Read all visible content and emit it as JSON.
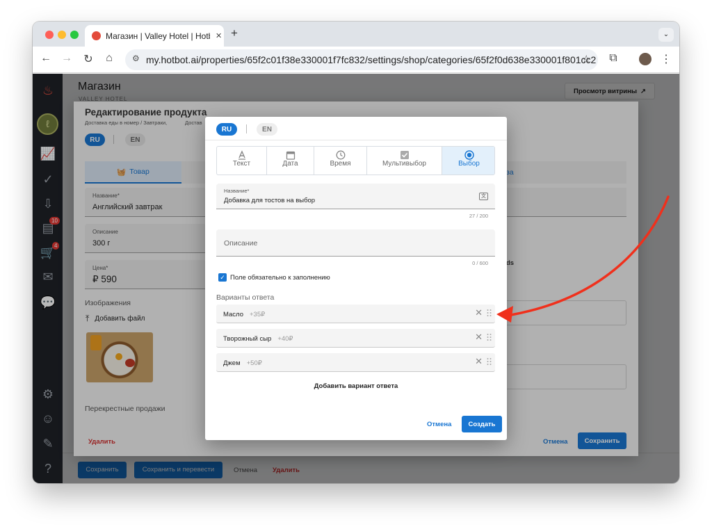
{
  "browser": {
    "tab_title": "Магазин | Valley Hotel | Hotbot",
    "new_tab": "+",
    "url": "my.hotbot.ai/properties/65f2c01f38e330001f7fc832/settings/shop/categories/65f2f0d638e330001f801cc2"
  },
  "page": {
    "title": "Магазин",
    "subtitle": "VALLEY HOTEL",
    "storefront_button": "Просмотр витрины",
    "bottom_save": "Сохранить",
    "bottom_save_translate": "Сохранить и перевести",
    "bottom_cancel": "Отмена",
    "bottom_delete": "Удалить"
  },
  "sidebar": {
    "badge_inbox": "10",
    "badge_cart": "4"
  },
  "product_panel": {
    "title": "Редактирование продукта",
    "breadcrumb": "Доставка еды в номер / Завтраки,",
    "breadcrumb_cut": "Достав",
    "lang_ru": "RU",
    "lang_en": "EN",
    "tab_product": "Товар",
    "tab_right_partial": "за",
    "name_label": "Название*",
    "name_value": "Английский завтрак",
    "desc_label": "Описание",
    "desc_value": "300 г",
    "price_label": "Цена*",
    "price_value": "₽ 590",
    "images_label": "Изображения",
    "add_file": "Добавить файл",
    "cross_sales": "Перекрестные продажи",
    "delete": "Удалить",
    "cancel": "Отмена",
    "save": "Сохранить",
    "partial_ds": "ds"
  },
  "dialog": {
    "lang_ru": "RU",
    "lang_en": "EN",
    "types": [
      {
        "label": "Текст",
        "icon": "text-icon"
      },
      {
        "label": "Дата",
        "icon": "calendar-icon"
      },
      {
        "label": "Время",
        "icon": "clock-icon"
      },
      {
        "label": "Мультивыбор",
        "icon": "checkbox-icon"
      },
      {
        "label": "Выбор",
        "icon": "radio-icon"
      }
    ],
    "selected_type": "Выбор",
    "name_label": "Название*",
    "name_value": "Добавка для тостов на выбор",
    "name_counter": "27 / 200",
    "desc_placeholder": "Описание",
    "desc_counter": "0 / 600",
    "required_label": "Поле обязательно к заполнению",
    "required_checked": true,
    "options_label": "Варианты ответа",
    "options": [
      {
        "name": "Масло",
        "price": "+35₽"
      },
      {
        "name": "Творожный сыр",
        "price": "+40₽"
      },
      {
        "name": "Джем",
        "price": "+50₽"
      }
    ],
    "add_option": "Добавить вариант ответа",
    "cancel": "Отмена",
    "create": "Создать"
  },
  "colors": {
    "accent": "#1976d2",
    "danger": "#d32f2f",
    "arrow": "#f0301c",
    "sidebar": "#1f2228",
    "selected_segment": "#e3f0fb"
  }
}
